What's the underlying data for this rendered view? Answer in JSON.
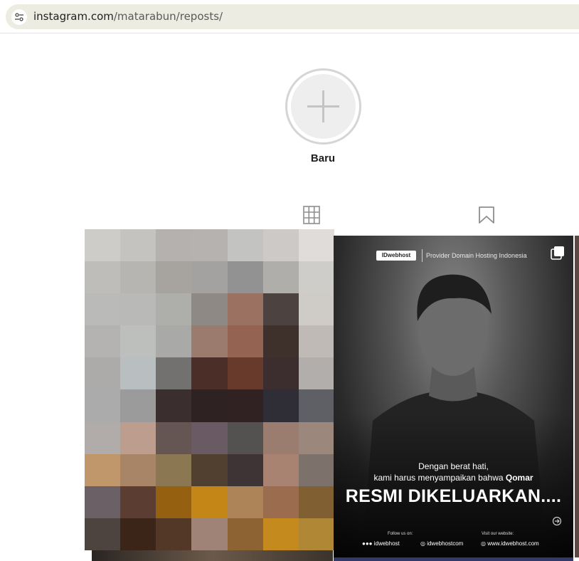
{
  "browser": {
    "url_host": "instagram.com",
    "url_path": "/matarabun/reposts/"
  },
  "highlight": {
    "new_label": "Baru"
  },
  "tabs": [
    {
      "icon": "grid-icon"
    },
    {
      "icon": "bookmark-icon"
    }
  ],
  "posts": [
    {
      "type": "pixelated-image"
    },
    {
      "type": "image-carousel",
      "brand_badge": "IDwebhost",
      "tagline": "Provider Domain Hosting Indonesia",
      "line1": "Dengan berat hati,",
      "line2_prefix": "kami harus menyampaikan bahwa ",
      "line2_name": "Qomar",
      "headline": "RESMI DIKELUARKAN....",
      "follow_label": "Follow us on:",
      "social_handle": "idwebhost",
      "web_handle": "idwebhostcom",
      "site_label": "Visit our website:",
      "site_url": "www.idwebhost.com"
    }
  ],
  "colors": {
    "urlbar_bg": "#ecece2",
    "new_circle_ring": "#d5d5d5",
    "pixel_colors": [
      "#cdccc9",
      "#c4c3c0",
      "#b4b1ae",
      "#b5b2af",
      "#c3c3c1",
      "#ccc9c6",
      "#dfdcd9",
      "#bebdba",
      "#b6b5b1",
      "#a7a4a0",
      "#a3a2a0",
      "#939292",
      "#b0aeab",
      "#cfcdca",
      "#babab8",
      "#b9bab7",
      "#aeaeab",
      "#8f8986",
      "#9b7162",
      "#4c4341",
      "#cfcbc7",
      "#b4b3b1",
      "#bdbfbc",
      "#a9a9a8",
      "#9a7b6d",
      "#946352",
      "#3e302b",
      "#bfbab5",
      "#acabaa",
      "#b9bfc0",
      "#727170",
      "#4a2e27",
      "#673a2c",
      "#3c2e2e",
      "#b1aeab",
      "#acabab",
      "#9b9b9c",
      "#3b2e2f",
      "#2e2223",
      "#302222",
      "#2f2e36",
      "#5f5f66",
      "#b1acaa",
      "#bd9d8d",
      "#655653",
      "#695a63",
      "#545151",
      "#9a7d6f",
      "#9c877d",
      "#c0966b",
      "#a98568",
      "#8b7853",
      "#51402f",
      "#3f3435",
      "#a98371",
      "#7d716b",
      "#6b6065",
      "#5c3d31",
      "#95600f",
      "#c48616",
      "#ad8457",
      "#9b6d4e",
      "#805f32",
      "#4e443f",
      "#3b2418",
      "#533827",
      "#9f8376",
      "#8e6334",
      "#c48a1d",
      "#b08735"
    ]
  }
}
